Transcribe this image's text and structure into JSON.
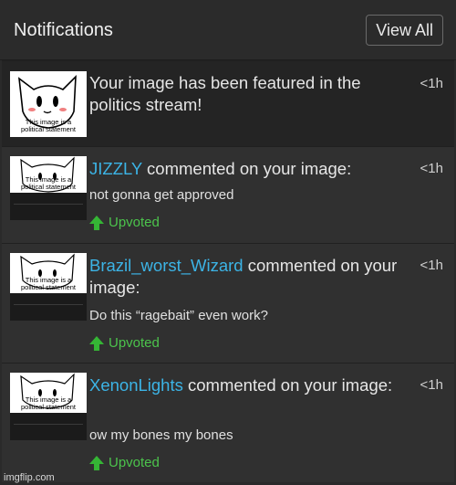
{
  "header": {
    "title": "Notifications",
    "view_all_label": "View All"
  },
  "notifications": [
    {
      "type": "featured",
      "text": "Your image has been featured in the politics stream!",
      "time": "<1h",
      "thumbnail_caption": "This image is a political statement"
    },
    {
      "type": "comment",
      "user": "JIZZLY",
      "action": " commented on your image:",
      "comment": "not gonna get approved",
      "status": "Upvoted",
      "time": "<1h",
      "thumbnail_caption": "This image is a political statement"
    },
    {
      "type": "comment",
      "user": "Brazil_worst_Wizard",
      "action": " commented on your image:",
      "comment": "Do this “ragebait” even work?",
      "status": "Upvoted",
      "time": "<1h",
      "thumbnail_caption": "This image is a political statement"
    },
    {
      "type": "comment",
      "user": "XenonLights",
      "action": " commented on your image:",
      "comment": "ow my bones my bones",
      "status": "Upvoted",
      "time": "<1h",
      "thumbnail_caption": "This image is a political statement"
    }
  ],
  "watermark": "imgflip.com",
  "colors": {
    "username": "#3cb4e6",
    "upvoted": "#4cc44c",
    "background": "#2a2a2a"
  }
}
